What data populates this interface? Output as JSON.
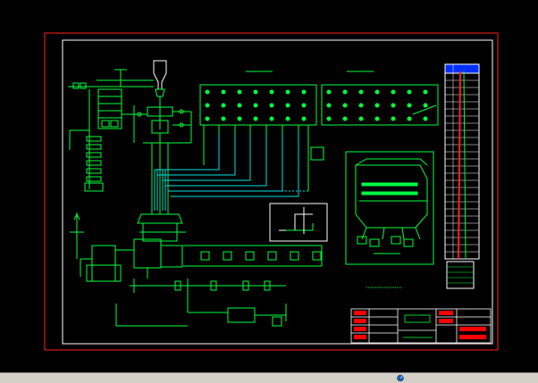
{
  "window": {
    "background": "#000000",
    "statusbar_color": "#d4d0c8"
  },
  "palette": {
    "frame": "#ff2020",
    "line": "#00ff40",
    "cyan": "#00e0e0",
    "white": "#ffffff",
    "red": "#ff0000",
    "yellow": "#ffff00"
  },
  "statusbar": {
    "dial_icon": "dial-icon"
  }
}
